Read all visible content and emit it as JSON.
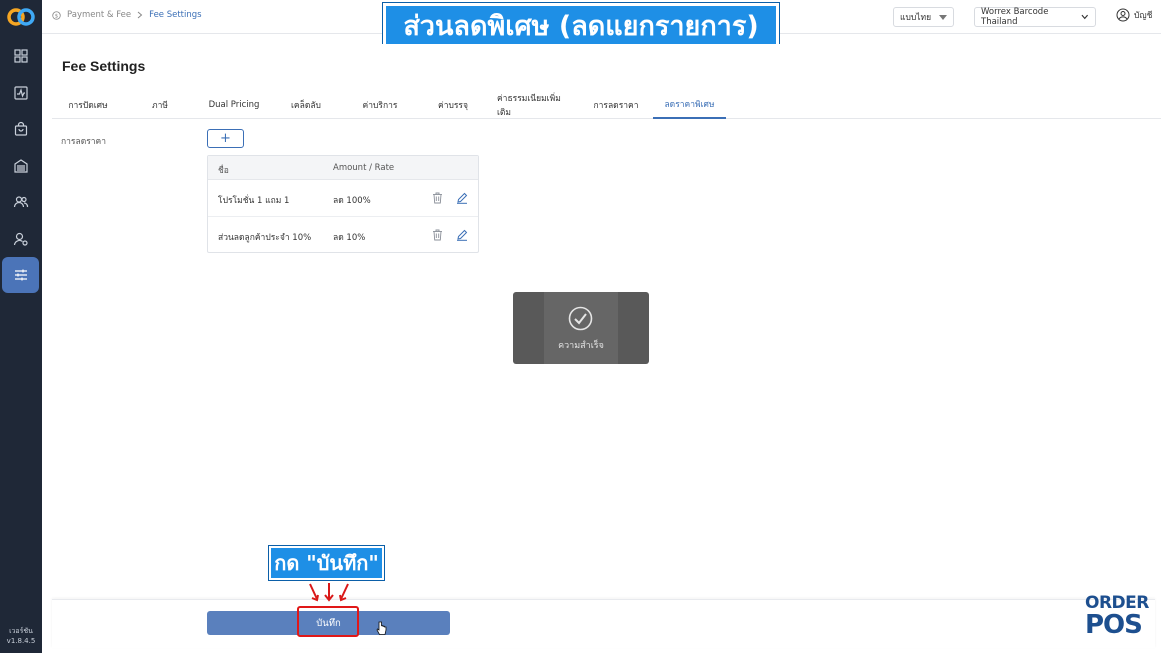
{
  "app": {
    "version_label": "เวอร์ชัน",
    "version": "v1.8.4.5"
  },
  "breadcrumb": {
    "parent": "Payment & Fee",
    "current": "Fee Settings"
  },
  "header": {
    "language": "แบบไทย",
    "store": "Worrex Barcode Thailand",
    "account": "บัญชี"
  },
  "banner": {
    "text": "ส่วนลดพิเศษ (ลดแยกรายการ)"
  },
  "page": {
    "title": "Fee Settings"
  },
  "tabs": [
    {
      "label": "การปัดเศษ"
    },
    {
      "label": "ภาษี"
    },
    {
      "label": "Dual Pricing"
    },
    {
      "label": "เคล็ดลับ"
    },
    {
      "label": "ค่าบริการ"
    },
    {
      "label": "ค่าบรรจุ"
    },
    {
      "label": "ค่าธรรมเนียมเพิ่มเติม"
    },
    {
      "label": "การลดราคา"
    },
    {
      "label": "ลดราคาพิเศษ"
    }
  ],
  "active_tab": "ลดราคาพิเศษ",
  "discount": {
    "field_label": "การลดราคา",
    "add_label": "+",
    "columns": {
      "name": "ชื่อ",
      "amount": "Amount / Rate"
    },
    "rows": [
      {
        "name": "โปรโมชั่น 1 แถม 1",
        "amount": "ลด 100%"
      },
      {
        "name": "ส่วนลดลูกค้าประจำ 10%",
        "amount": "ลด 10%"
      }
    ]
  },
  "toast": {
    "text": "ความสำเร็จ"
  },
  "footer": {
    "save_label": "บันทึก"
  },
  "callout": {
    "text": "กด \"บันทึก\""
  },
  "brand": {
    "line1": "ORDER",
    "line2": "POS"
  },
  "colors": {
    "sidebar": "#1f2837",
    "accent": "#3b6fb6",
    "save": "#5a80bd",
    "banner": "#1e8fe6",
    "highlight": "#e01818"
  }
}
